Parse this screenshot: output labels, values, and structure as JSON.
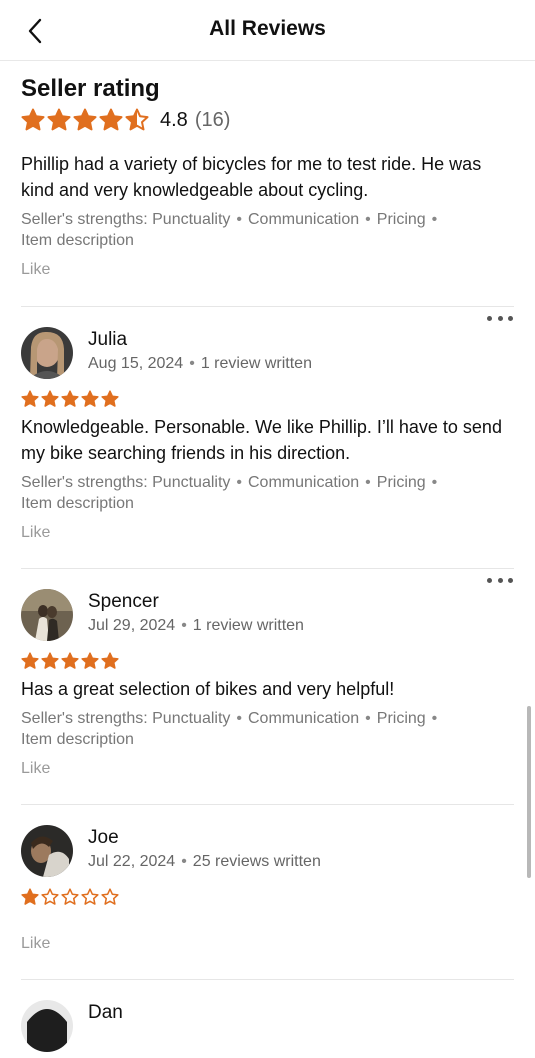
{
  "header": {
    "title": "All Reviews",
    "back_icon": "chevron-left-icon"
  },
  "summary": {
    "heading": "Seller rating",
    "rating": "4.8",
    "count": "(16)",
    "stars": 4.5,
    "text": "Phillip had a variety of bicycles for me to test ride. He was kind and very knowledgeable about cycling.",
    "strengths_label": "Seller's strengths:",
    "strengths": [
      "Punctuality",
      "Communication",
      "Pricing",
      "Item description"
    ],
    "like": "Like"
  },
  "reviews": [
    {
      "name": "Julia",
      "date": "Aug 15, 2024",
      "written": "1 review written",
      "stars": 5,
      "text": "Knowledgeable. Personable. We like Phillip. I’ll have to send my bike searching friends in his direction.",
      "strengths_label": "Seller's strengths:",
      "strengths": [
        "Punctuality",
        "Communication",
        "Pricing",
        "Item description"
      ],
      "like": "Like"
    },
    {
      "name": "Spencer",
      "date": "Jul 29, 2024",
      "written": "1 review written",
      "stars": 5,
      "text": "Has a great selection of bikes and very helpful!",
      "strengths_label": "Seller's strengths:",
      "strengths": [
        "Punctuality",
        "Communication",
        "Pricing",
        "Item description"
      ],
      "like": "Like"
    },
    {
      "name": "Joe",
      "date": "Jul 22, 2024",
      "written": "25 reviews written",
      "stars": 1,
      "text": "",
      "like": "Like"
    },
    {
      "name": "Dan"
    }
  ],
  "colors": {
    "star": "#e06f1f",
    "star_empty_stroke": "#e06f1f",
    "text_secondary": "#777777",
    "divider": "#e6e6e6"
  }
}
